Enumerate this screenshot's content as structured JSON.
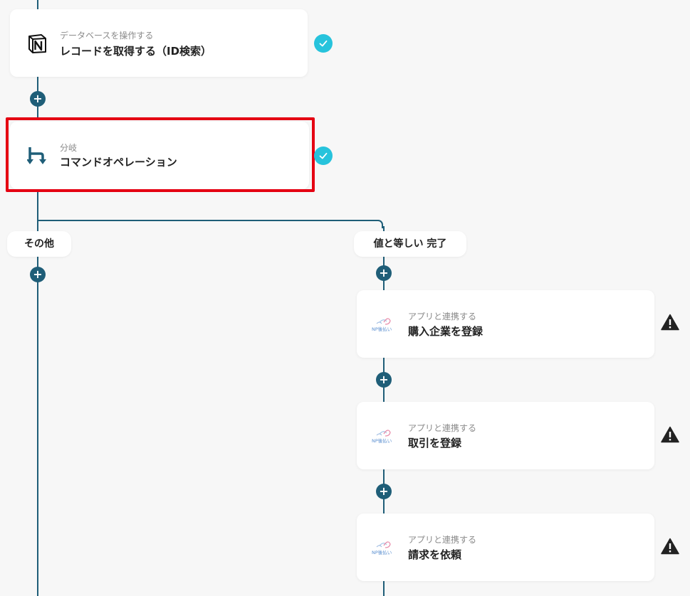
{
  "flow": {
    "steps": [
      {
        "subtitle": "データベースを操作する",
        "title": "レコードを取得する（ID検索）",
        "icon": "notion-icon",
        "status": "check"
      },
      {
        "subtitle": "分岐",
        "title": "コマンドオペレーション",
        "icon": "branch-icon",
        "status": "check"
      }
    ],
    "branches": {
      "other_label": "その他",
      "equal_label": "値と等しい 完了"
    },
    "sub_steps": [
      {
        "subtitle": "アプリと連携する",
        "title": "購入企業を登録",
        "icon": "np-payment-icon",
        "status": "warning"
      },
      {
        "subtitle": "アプリと連携する",
        "title": "取引を登録",
        "icon": "np-payment-icon",
        "status": "warning"
      },
      {
        "subtitle": "アプリと連携する",
        "title": "請求を依頼",
        "icon": "np-payment-icon",
        "status": "warning"
      }
    ],
    "add_symbol": "+",
    "logo_text": "NP後払い"
  },
  "colors": {
    "line": "#1f5e78",
    "check": "#27c3dc",
    "highlight": "#e50012",
    "warning": "#222222"
  }
}
